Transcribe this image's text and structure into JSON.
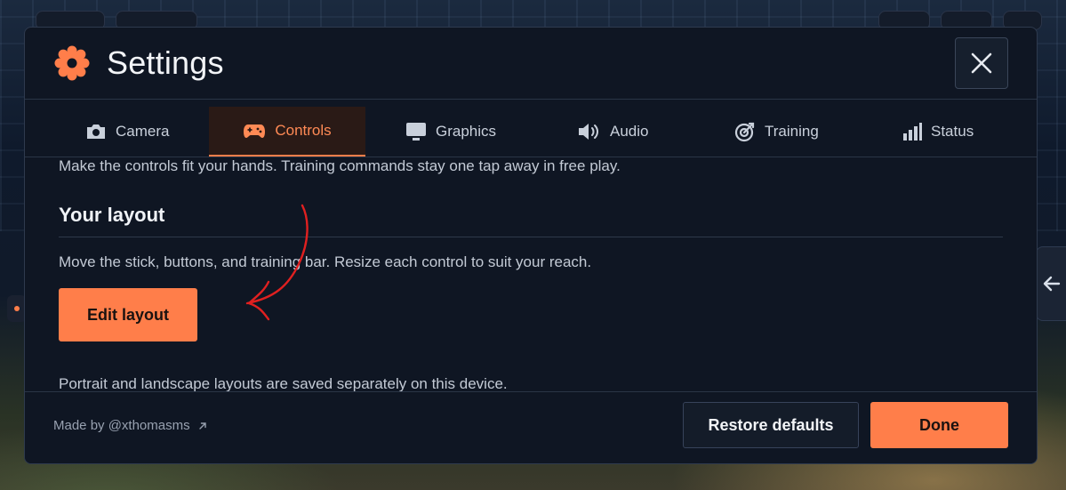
{
  "modal": {
    "title": "Settings",
    "title_icon": "gear-icon",
    "close_icon": "close-icon"
  },
  "tabs": [
    {
      "label": "Camera",
      "icon": "camera-icon",
      "active": false
    },
    {
      "label": "Controls",
      "icon": "gamepad-icon",
      "active": true
    },
    {
      "label": "Graphics",
      "icon": "monitor-icon",
      "active": false
    },
    {
      "label": "Audio",
      "icon": "speaker-icon",
      "active": false
    },
    {
      "label": "Training",
      "icon": "target-icon",
      "active": false
    },
    {
      "label": "Status",
      "icon": "bar-chart-icon",
      "active": false
    }
  ],
  "controls": {
    "intro": "Make the controls fit your hands. Training commands stay one tap away in free play.",
    "section_title": "Your layout",
    "description": "Move the stick, buttons, and training bar. Resize each control to suit your reach.",
    "edit_button": "Edit layout",
    "note": "Portrait and landscape layouts are saved separately on this device."
  },
  "footer": {
    "made_by": "Made by @xthomasms",
    "made_by_icon": "external-link-icon",
    "restore_button": "Restore defaults",
    "done_button": "Done"
  },
  "colors": {
    "accent": "#ff7e4a",
    "modal_bg": "#0f1623",
    "annotation": "#e02020"
  },
  "side_handle_icon": "arrow-left-icon"
}
